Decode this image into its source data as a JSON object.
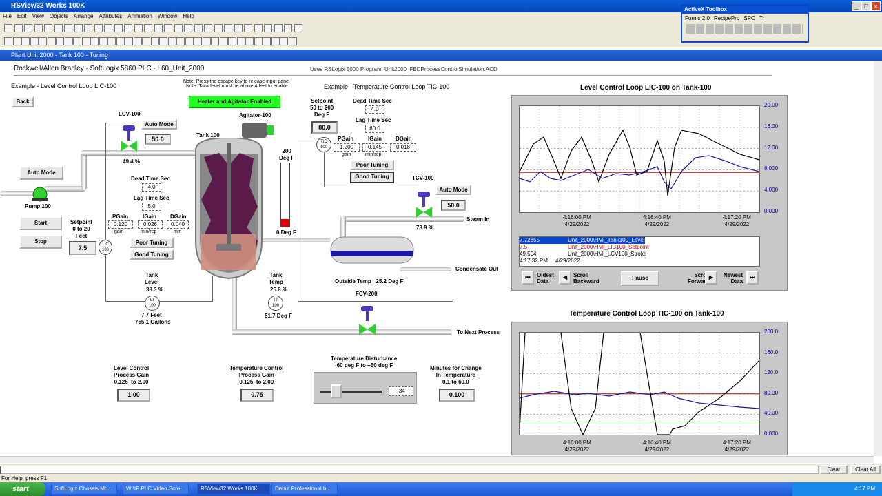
{
  "window": {
    "title": "RSView32 Works 100K"
  },
  "menu": [
    "File",
    "Edit",
    "View",
    "Objects",
    "Arrange",
    "Attributes",
    "Animation",
    "Window",
    "Help"
  ],
  "activex": {
    "title": "ActiveX Toolbox",
    "tabs": [
      "Forms 2.0",
      "RecipePro",
      "SPC",
      "Tr"
    ]
  },
  "display": {
    "title": "Plant Unit 2000 - Tank 100 - Tuning"
  },
  "header": {
    "left": "Rockwell/Allen Bradley - SoftLogix 5860 PLC - L60_Unit_2000",
    "right": "Uses RSLogix 5000 Program: Unit2000_FBDProcessControlSimulation.ACD"
  },
  "level_loop": {
    "title": "Example - Level Control Loop LIC-100",
    "back": "Back",
    "valve_tag": "LCV-100",
    "auto_mode": "Auto Mode",
    "output": "50.0",
    "valve_pct": "49.4 %",
    "pump_auto": "Auto Mode",
    "pump_label": "Pump 100",
    "start": "Start",
    "stop": "Stop",
    "setpoint_label": "Setpoint\n0 to 20\nFeet",
    "setpoint": "7.5",
    "lic": "LIC\n100",
    "dead_time_label": "Dead Time Sec",
    "dead_time": "4.0",
    "lag_time_label": "Lag Time Sec",
    "lag_time": "5.0",
    "pgain_label": "PGain",
    "igain_label": "IGain",
    "dgain_label": "DGain",
    "pgain": "0.120",
    "igain": "0.026",
    "dgain": "0.040",
    "pgain_unit": "gain",
    "igain_unit": "min/rep",
    "dgain_unit": "min",
    "poor": "Poor Tuning",
    "good": "Good Tuning",
    "tank_level_label": "Tank\nLevel",
    "tank_level_pct": "38.3 %",
    "lt": "LT\n100",
    "level_feet": "7.7 Feet",
    "level_gallons": "765.1 Gallons"
  },
  "notes": {
    "line1": "Note: Press the escape key to release input panel",
    "line2": "Note: Tank level must be above 4 feet to enable"
  },
  "heater_status": "Heater and Agitator Enabled",
  "agitator": "Agitator-100",
  "tank": "Tank 100",
  "thermo": {
    "top": "200\nDeg F",
    "bottom": "0 Deg F",
    "fill_fraction": 0.12
  },
  "temp_loop": {
    "title": "Example - Temperature Control Loop TIC-100",
    "setpoint_label": "Setpoint\n50 to 200\nDeg F",
    "setpoint": "80.0",
    "tic": "TIC\n100",
    "dead_time_label": "Dead Time Sec",
    "dead_time": "4.0",
    "lag_time_label": "Lag Time Sec",
    "lag_time": "60.0",
    "pgain_label": "PGain",
    "igain_label": "IGain",
    "dgain_label": "DGain",
    "pgain": "1.200",
    "igain": "0.145",
    "dgain": "0.018",
    "pgain_unit": "gain",
    "igain_unit": "min/rep",
    "poor": "Poor Tuning",
    "good": "Good Tuning",
    "valve_tag": "TCV-100",
    "auto_mode": "Auto Mode",
    "output": "50.0",
    "valve_pct": "73.9 %",
    "steam_in": "Steam In",
    "condensate_out": "Condensate Out",
    "outside_temp": "Outside Temp   25.2 Deg F",
    "tank_temp_label": "Tank\nTemp",
    "tank_temp_pct": "25.8 %",
    "tt": "TT\n100",
    "temp_deg": "51.7 Deg F",
    "fcv": "FCV-200",
    "next_process": "To Next Process"
  },
  "bottom": {
    "level_gain_label": "Level Control\nProcess Gain\n0.125  to 2.00",
    "level_gain": "1.00",
    "temp_gain_label": "Temperature Control\nProcess Gain\n0.125  to 2.00",
    "temp_gain": "0.75",
    "disturbance_label": "Temperature Disturbance\n-60 deg F to +60 deg F",
    "disturbance": "-34",
    "minutes_label": "Minutes for Change\nIn Temperature\n0.1 to 60.0",
    "minutes": "0.100"
  },
  "trend1": {
    "title": "Level Control Loop LIC-100 on Tank-100",
    "yticks": [
      "20.00",
      "16.00",
      "12.00",
      "8.000",
      "4.000",
      "0.000"
    ],
    "xticks": [
      {
        "t": "4:16:00 PM",
        "d": "4/29/2022"
      },
      {
        "t": "4:16:40 PM",
        "d": "4/29/2022"
      },
      {
        "t": "4:17:20 PM",
        "d": "4/29/2022"
      }
    ],
    "legend": [
      {
        "val": "7.72855",
        "tag": "Unit_2000\\HMI_Tank100_Level"
      },
      {
        "val": "7.5",
        "tag": "Unit_2000\\HMI_LIC100_Setpoint"
      },
      {
        "val": "49.504",
        "tag": "Unit_2000\\HMI_LCV100_Stroke"
      }
    ],
    "cursor_time": "4:17:32 PM",
    "cursor_date": "4/29/2022",
    "oldest": "Oldest\nData",
    "scroll_back": "Scroll\nBackward",
    "pause": "Pause",
    "scroll_fwd": "Scroll\nForward",
    "newest": "Newest\nData"
  },
  "trend2": {
    "title": "Temperature Control Loop TIC-100 on Tank-100",
    "yticks": [
      "200.0",
      "160.0",
      "120.0",
      "80.00",
      "40.00",
      "0.000"
    ],
    "xticks": [
      {
        "t": "4:16:00 PM",
        "d": "4/29/2022"
      },
      {
        "t": "4:16:40 PM",
        "d": "4/29/2022"
      },
      {
        "t": "4:17:20 PM",
        "d": "4/29/2022"
      }
    ]
  },
  "status": {
    "help": "For Help, press F1",
    "clear": "Clear",
    "clear_all": "Clear All"
  },
  "taskbar": {
    "start": "start",
    "items": [
      "SoftLogix Chassis Mo...",
      "W:\\IP PLC Video Scre...",
      "RSView32 Works 100K",
      "Debut Professional b..."
    ],
    "time": "4:17 PM"
  }
}
